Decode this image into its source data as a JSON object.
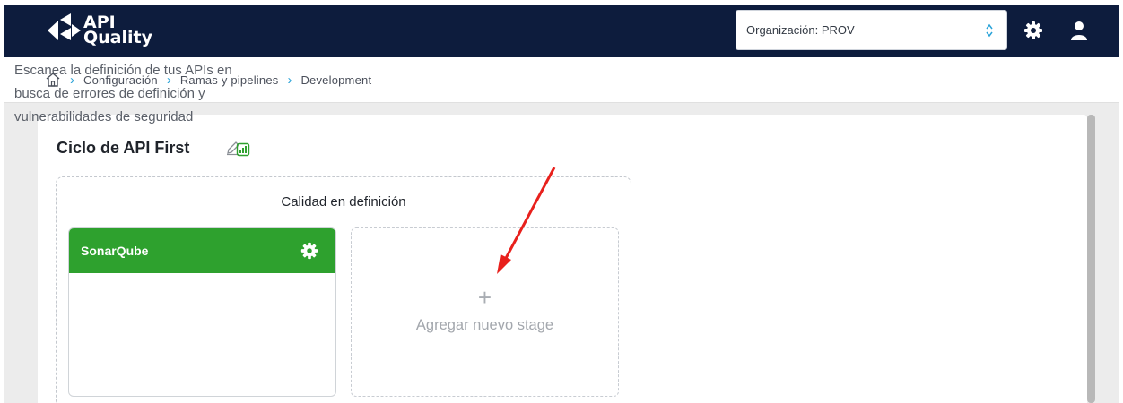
{
  "app": {
    "logo_line1": "API",
    "logo_line2": "Quality"
  },
  "header": {
    "org_select_value": "Organización: PROV",
    "settings_icon": "gear-icon",
    "user_icon": "user-icon"
  },
  "breadcrumb": {
    "home_icon": "home-icon",
    "items": [
      "Configuración",
      "Ramas y pipelines",
      "Development"
    ]
  },
  "cycle": {
    "title": "Ciclo de API First",
    "edit_icon": "pencil-icon"
  },
  "stage_group": {
    "title": "Calidad en definición",
    "stages": [
      {
        "name": "SonarQube",
        "description": "Escanea la definición de tus APIs en busca de errores de definición y vulnerabilidades de seguridad",
        "color": "#2ea12e"
      }
    ],
    "add_plus": "+",
    "add_label": "Agregar nuevo stage"
  },
  "colors": {
    "topbar": "#0d1c3d",
    "accent": "#2aa3d8",
    "stage_green": "#2ea12e",
    "annotation_arrow": "#e8201c"
  }
}
